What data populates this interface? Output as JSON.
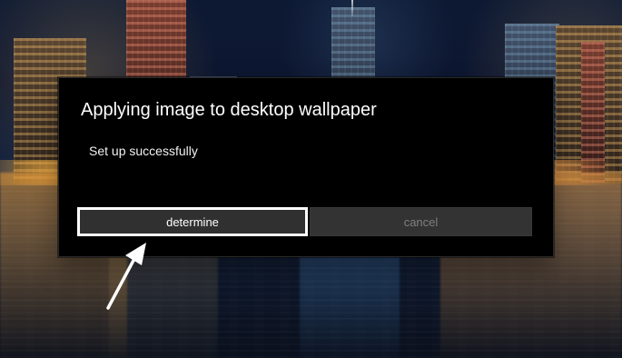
{
  "dialog": {
    "title": "Applying image to desktop wallpaper",
    "message": "Set up successfully"
  },
  "actions": {
    "primary_label": "determine",
    "secondary_label": "cancel"
  },
  "annotation": {
    "icon": "arrow-pointer-icon"
  }
}
